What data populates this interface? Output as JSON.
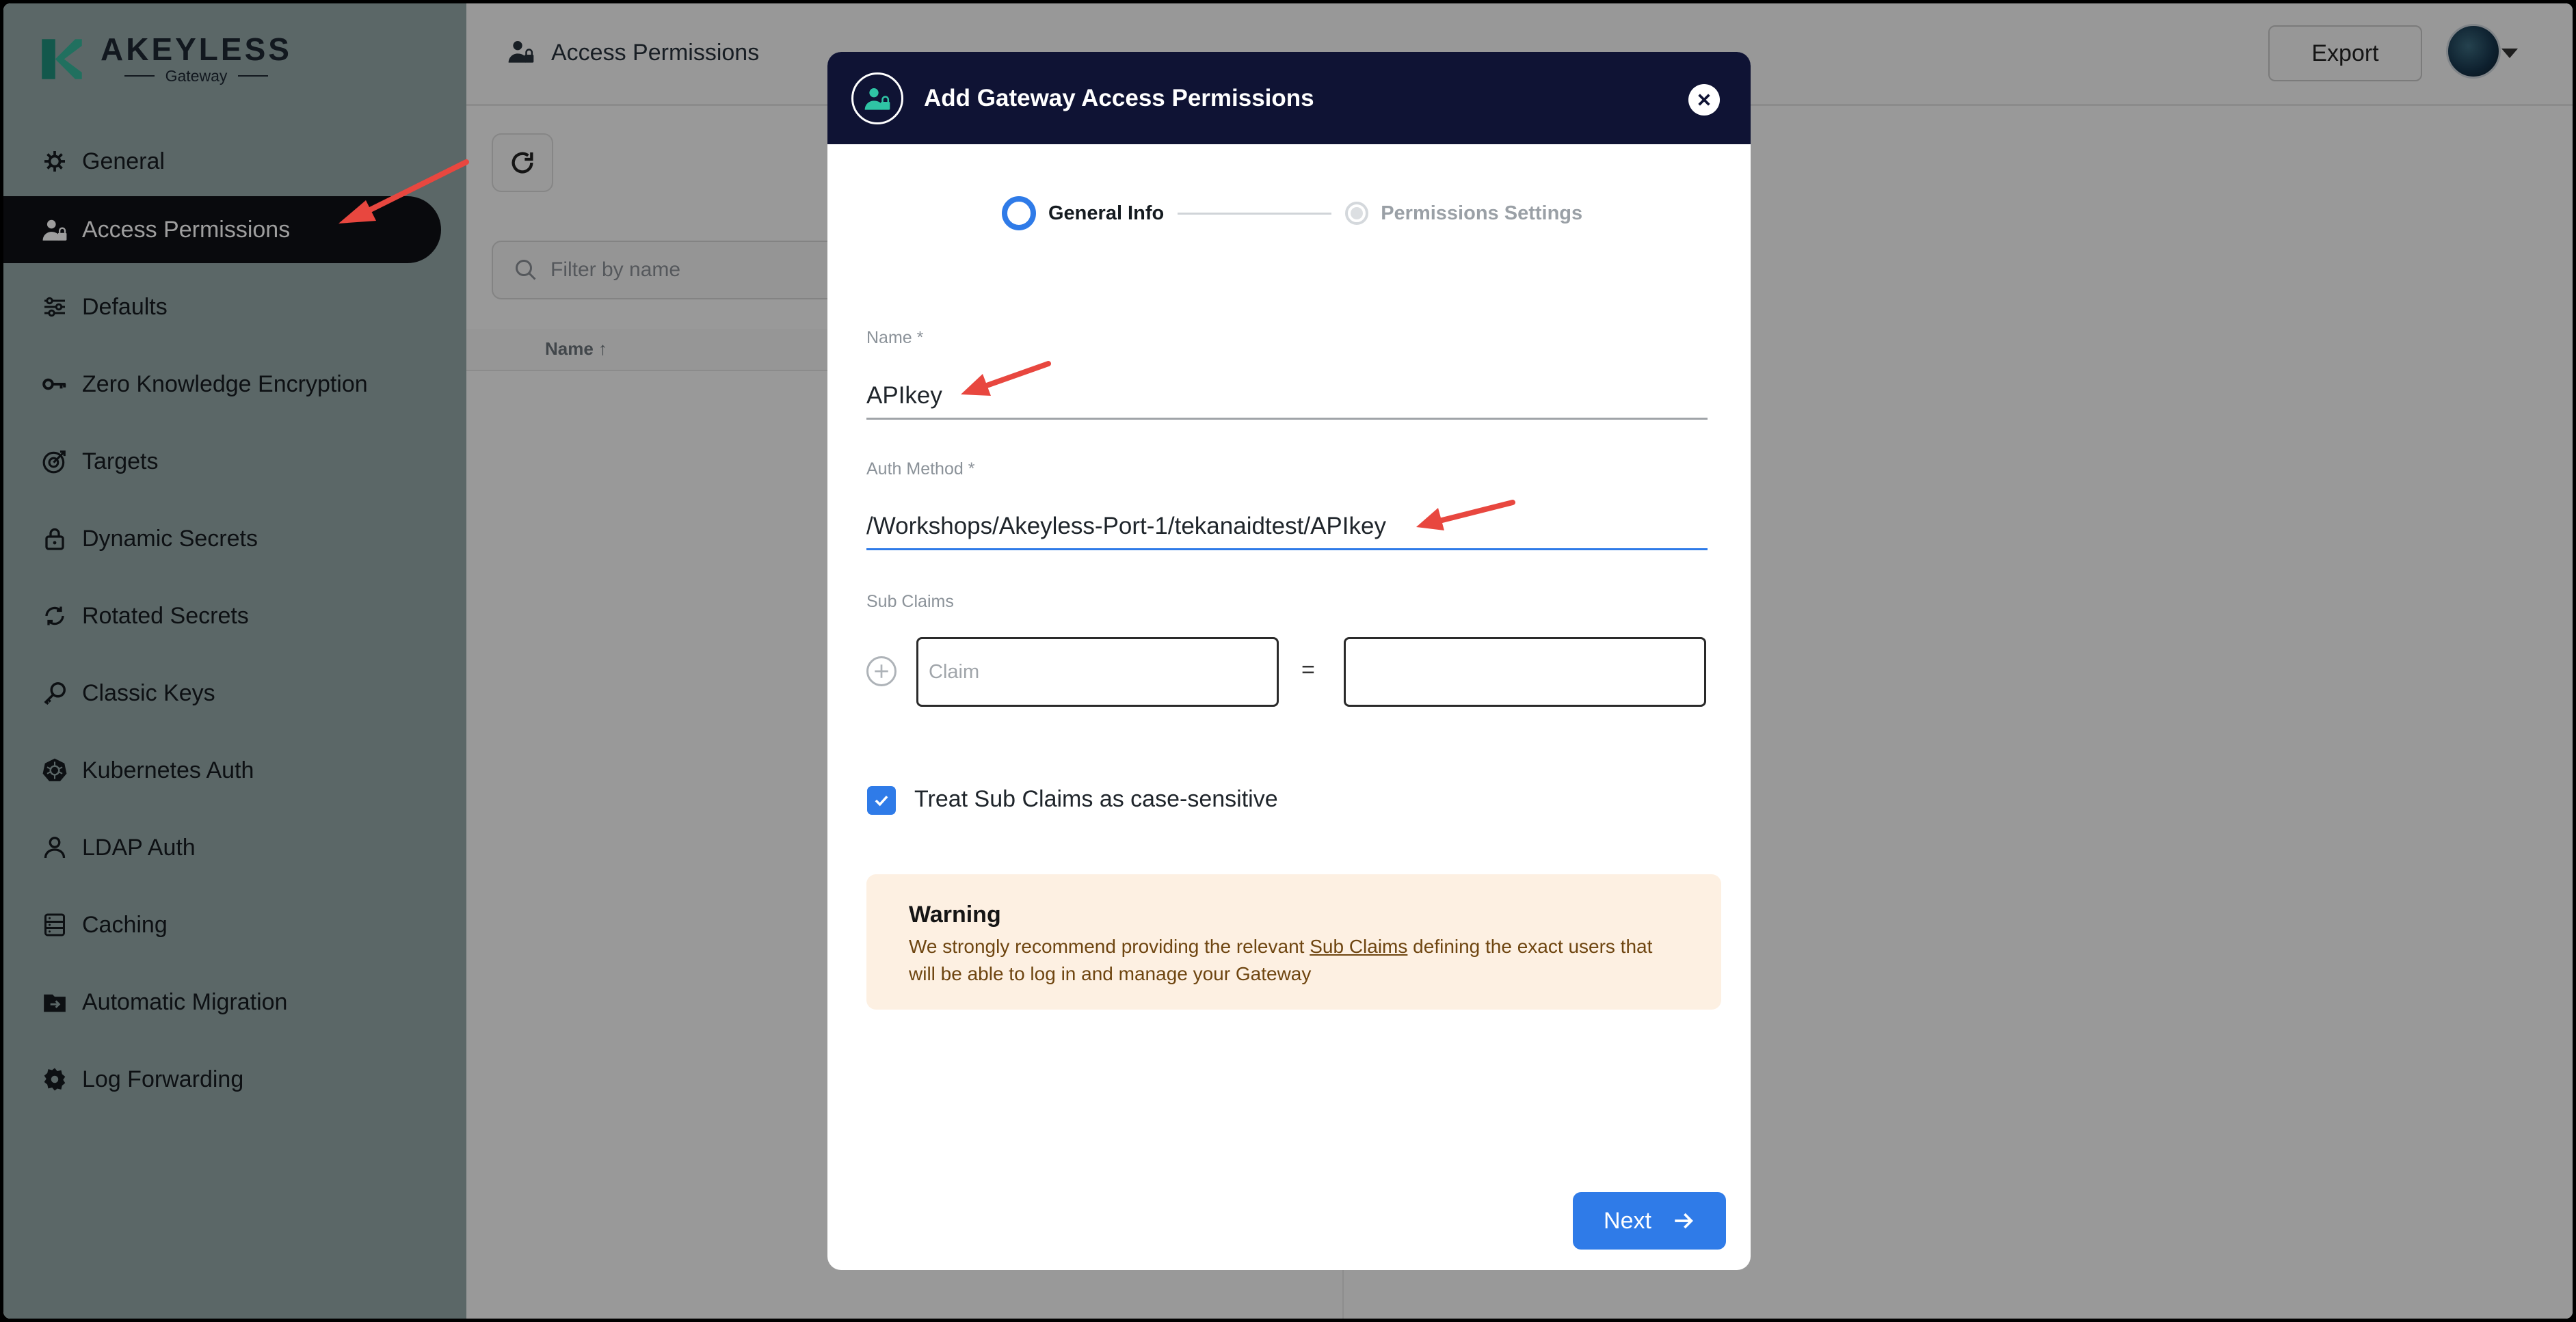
{
  "sidebar": {
    "logo": {
      "brand": "AKEYLESS",
      "sub": "Gateway"
    },
    "items": [
      {
        "label": "General",
        "icon": "gear-cog-icon"
      },
      {
        "label": "Access Permissions",
        "icon": "user-lock-icon",
        "active": true
      },
      {
        "label": "Defaults",
        "icon": "sliders-icon"
      },
      {
        "label": "Zero Knowledge Encryption",
        "icon": "key-icon"
      },
      {
        "label": "Targets",
        "icon": "target-icon"
      },
      {
        "label": "Dynamic Secrets",
        "icon": "padlock-icon"
      },
      {
        "label": "Rotated Secrets",
        "icon": "rotate-icon"
      },
      {
        "label": "Classic Keys",
        "icon": "classic-key-icon"
      },
      {
        "label": "Kubernetes Auth",
        "icon": "kubernetes-icon"
      },
      {
        "label": "LDAP Auth",
        "icon": "person-icon"
      },
      {
        "label": "Caching",
        "icon": "database-icon"
      },
      {
        "label": "Automatic Migration",
        "icon": "migration-icon"
      },
      {
        "label": "Log Forwarding",
        "icon": "settings-icon"
      }
    ]
  },
  "header": {
    "title": "Access Permissions",
    "export_label": "Export"
  },
  "main": {
    "filter_placeholder": "Filter by name",
    "column_name": "Name ↑"
  },
  "modal": {
    "title": "Add Gateway Access Permissions",
    "steps": [
      {
        "label": "General Info",
        "state": "active"
      },
      {
        "label": "Permissions Settings",
        "state": "inactive"
      }
    ],
    "name_label": "Name *",
    "name_value": "APIkey",
    "auth_label": "Auth Method *",
    "auth_value": "/Workshops/Akeyless-Port-1/tekanaidtest/APIkey",
    "subclaims_label": "Sub Claims",
    "claim_placeholder": "Claim",
    "equals": "=",
    "checkbox_label": "Treat Sub Claims as case-sensitive",
    "checkbox_checked": true,
    "warning": {
      "title": "Warning",
      "body_before": "We strongly recommend providing the relevant ",
      "link": "Sub Claims",
      "body_after": " defining the exact users that will be able to log in and manage your Gateway"
    },
    "next_label": "Next"
  },
  "colors": {
    "accent": "#2f7be8",
    "modal_header": "#0f1334",
    "sidebar_bg": "#93a6a7",
    "annotation_arrow": "#e8473f",
    "logo_teal": "#1f8f7b"
  }
}
